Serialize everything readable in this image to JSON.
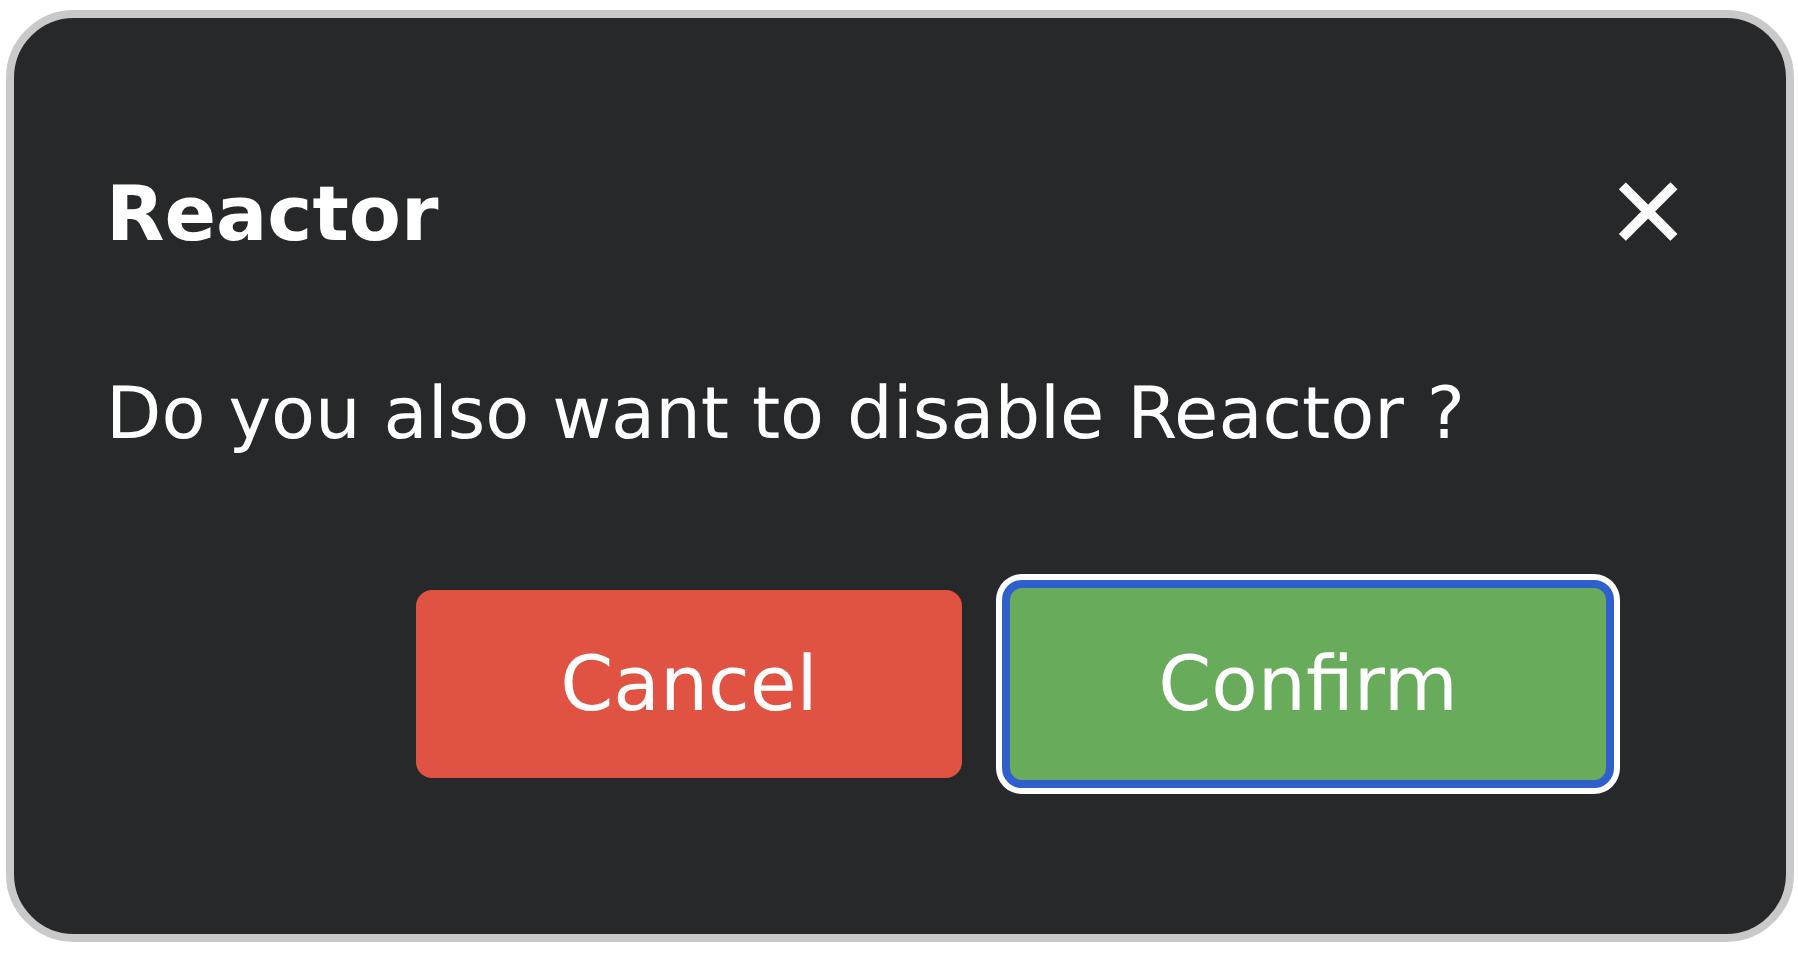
{
  "dialog": {
    "title": "Reactor",
    "close": "✕",
    "message": "Do you also want to disable Reactor ?"
  },
  "buttons": [
    {
      "label": "Cancel",
      "kind": "cancel",
      "focused": false
    },
    {
      "label": "Confirm",
      "kind": "confirm",
      "focused": true
    }
  ]
}
